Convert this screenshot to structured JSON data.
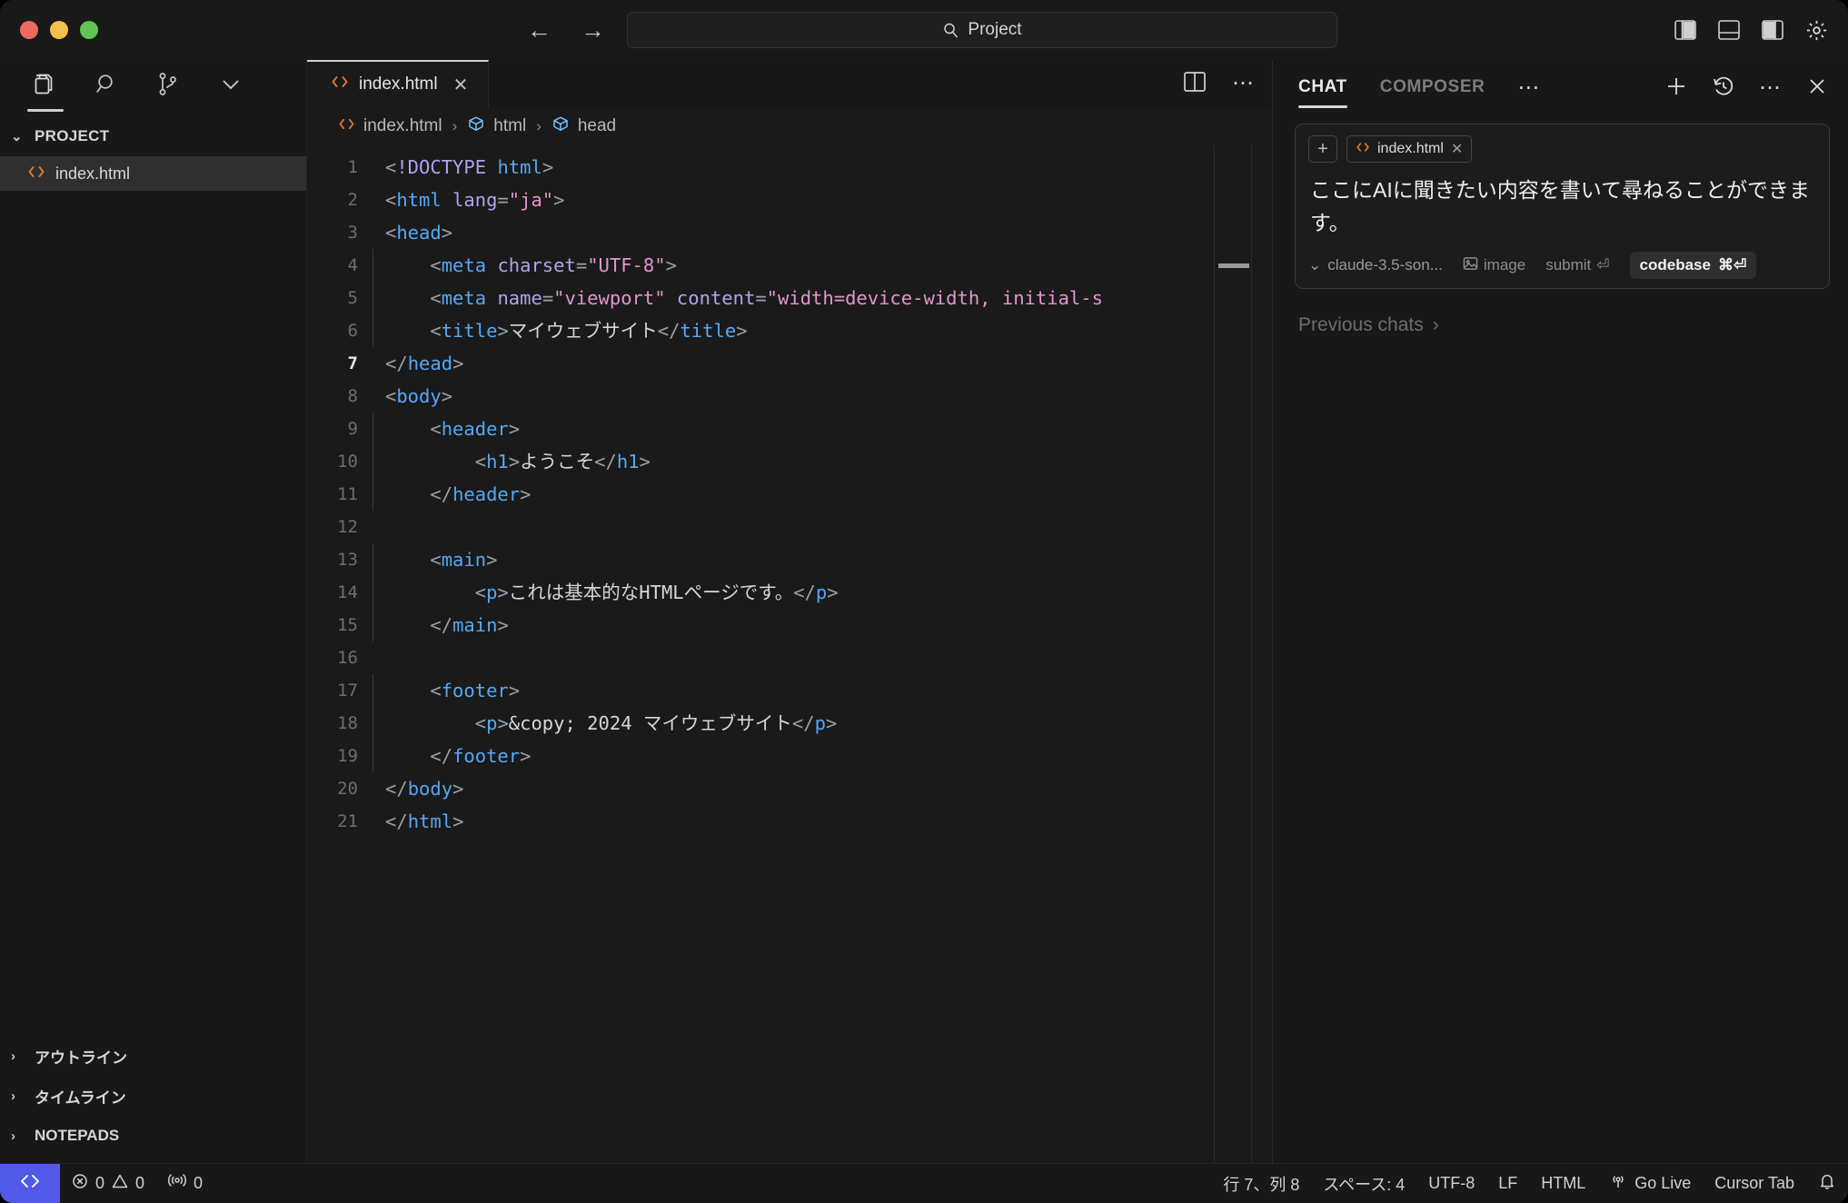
{
  "titlebar": {
    "search_value": "Project",
    "search_icon": "search-icon",
    "back_icon": "←",
    "forward_icon": "→",
    "layout_icons": [
      "toggle-primary-sidebar-icon",
      "toggle-panel-icon",
      "toggle-secondary-sidebar-icon",
      "settings-gear-icon"
    ]
  },
  "activitybar": {
    "items": [
      {
        "name": "explorer-icon",
        "active": true
      },
      {
        "name": "search-icon",
        "active": false
      },
      {
        "name": "source-control-icon",
        "active": false
      },
      {
        "name": "chevron-down-icon",
        "active": false
      }
    ]
  },
  "sidebar": {
    "title": "PROJECT",
    "chevron_open": "⌄",
    "files": [
      {
        "label": "index.html",
        "icon": "html-file-icon",
        "selected": true
      }
    ],
    "sections": [
      {
        "label": "アウトライン",
        "chevron": "›"
      },
      {
        "label": "タイムライン",
        "chevron": "›"
      },
      {
        "label": "NOTEPADS",
        "chevron": "›"
      }
    ]
  },
  "editor": {
    "tab": {
      "label": "index.html",
      "icon": "html-file-icon",
      "close": "✕"
    },
    "actions": {
      "split_icon": "split-editor-icon",
      "more": "⋯"
    },
    "breadcrumb": [
      {
        "label": "index.html",
        "icon": "html-file-icon"
      },
      {
        "label": "html",
        "icon": "symbol-cube-icon"
      },
      {
        "label": "head",
        "icon": "symbol-cube-icon"
      }
    ],
    "breadcrumb_separator": "›",
    "cursor_line": 7,
    "lines": [
      {
        "n": 1,
        "indent": 0,
        "guide": false,
        "tokens": [
          {
            "c": "punc",
            "t": "<"
          },
          {
            "c": "doctype",
            "t": "!DOCTYPE"
          },
          {
            "c": "text",
            "t": " "
          },
          {
            "c": "tag",
            "t": "html"
          },
          {
            "c": "punc",
            "t": ">"
          }
        ]
      },
      {
        "n": 2,
        "indent": 0,
        "guide": false,
        "tokens": [
          {
            "c": "punc",
            "t": "<"
          },
          {
            "c": "tag",
            "t": "html"
          },
          {
            "c": "text",
            "t": " "
          },
          {
            "c": "attr",
            "t": "lang"
          },
          {
            "c": "eq",
            "t": "="
          },
          {
            "c": "val",
            "t": "\"ja\""
          },
          {
            "c": "punc",
            "t": ">"
          }
        ]
      },
      {
        "n": 3,
        "indent": 0,
        "guide": false,
        "tokens": [
          {
            "c": "punc",
            "t": "<"
          },
          {
            "c": "tag",
            "t": "head"
          },
          {
            "c": "punc",
            "t": ">"
          }
        ]
      },
      {
        "n": 4,
        "indent": 1,
        "guide": true,
        "tokens": [
          {
            "c": "punc",
            "t": "<"
          },
          {
            "c": "tag",
            "t": "meta"
          },
          {
            "c": "text",
            "t": " "
          },
          {
            "c": "attr",
            "t": "charset"
          },
          {
            "c": "eq",
            "t": "="
          },
          {
            "c": "val",
            "t": "\"UTF-8\""
          },
          {
            "c": "punc",
            "t": ">"
          }
        ]
      },
      {
        "n": 5,
        "indent": 1,
        "guide": true,
        "tokens": [
          {
            "c": "punc",
            "t": "<"
          },
          {
            "c": "tag",
            "t": "meta"
          },
          {
            "c": "text",
            "t": " "
          },
          {
            "c": "attr",
            "t": "name"
          },
          {
            "c": "eq",
            "t": "="
          },
          {
            "c": "val",
            "t": "\"viewport\""
          },
          {
            "c": "text",
            "t": " "
          },
          {
            "c": "attr",
            "t": "content"
          },
          {
            "c": "eq",
            "t": "="
          },
          {
            "c": "val",
            "t": "\"width=device-width, initial-s"
          }
        ]
      },
      {
        "n": 6,
        "indent": 1,
        "guide": true,
        "tokens": [
          {
            "c": "punc",
            "t": "<"
          },
          {
            "c": "tag",
            "t": "title"
          },
          {
            "c": "punc",
            "t": ">"
          },
          {
            "c": "text",
            "t": "マイウェブサイト"
          },
          {
            "c": "punc",
            "t": "</"
          },
          {
            "c": "tag",
            "t": "title"
          },
          {
            "c": "punc",
            "t": ">"
          }
        ]
      },
      {
        "n": 7,
        "indent": 0,
        "guide": false,
        "current": true,
        "tokens": [
          {
            "c": "punc",
            "t": "</"
          },
          {
            "c": "tag",
            "t": "head"
          },
          {
            "c": "punc",
            "t": ">"
          }
        ]
      },
      {
        "n": 8,
        "indent": 0,
        "guide": false,
        "tokens": [
          {
            "c": "punc",
            "t": "<"
          },
          {
            "c": "tag",
            "t": "body"
          },
          {
            "c": "punc",
            "t": ">"
          }
        ]
      },
      {
        "n": 9,
        "indent": 1,
        "guide": true,
        "tokens": [
          {
            "c": "punc",
            "t": "<"
          },
          {
            "c": "tag",
            "t": "header"
          },
          {
            "c": "punc",
            "t": ">"
          }
        ]
      },
      {
        "n": 10,
        "indent": 2,
        "guide": true,
        "tokens": [
          {
            "c": "punc",
            "t": "<"
          },
          {
            "c": "tag",
            "t": "h1"
          },
          {
            "c": "punc",
            "t": ">"
          },
          {
            "c": "text",
            "t": "ようこそ"
          },
          {
            "c": "punc",
            "t": "</"
          },
          {
            "c": "tag",
            "t": "h1"
          },
          {
            "c": "punc",
            "t": ">"
          }
        ]
      },
      {
        "n": 11,
        "indent": 1,
        "guide": true,
        "tokens": [
          {
            "c": "punc",
            "t": "</"
          },
          {
            "c": "tag",
            "t": "header"
          },
          {
            "c": "punc",
            "t": ">"
          }
        ]
      },
      {
        "n": 12,
        "indent": 0,
        "guide": false,
        "tokens": []
      },
      {
        "n": 13,
        "indent": 1,
        "guide": true,
        "tokens": [
          {
            "c": "punc",
            "t": "<"
          },
          {
            "c": "tag",
            "t": "main"
          },
          {
            "c": "punc",
            "t": ">"
          }
        ]
      },
      {
        "n": 14,
        "indent": 2,
        "guide": true,
        "tokens": [
          {
            "c": "punc",
            "t": "<"
          },
          {
            "c": "tag",
            "t": "p"
          },
          {
            "c": "punc",
            "t": ">"
          },
          {
            "c": "text",
            "t": "これは基本的なHTMLページです。"
          },
          {
            "c": "punc",
            "t": "</"
          },
          {
            "c": "tag",
            "t": "p"
          },
          {
            "c": "punc",
            "t": ">"
          }
        ]
      },
      {
        "n": 15,
        "indent": 1,
        "guide": true,
        "tokens": [
          {
            "c": "punc",
            "t": "</"
          },
          {
            "c": "tag",
            "t": "main"
          },
          {
            "c": "punc",
            "t": ">"
          }
        ]
      },
      {
        "n": 16,
        "indent": 0,
        "guide": false,
        "tokens": []
      },
      {
        "n": 17,
        "indent": 1,
        "guide": true,
        "tokens": [
          {
            "c": "punc",
            "t": "<"
          },
          {
            "c": "tag",
            "t": "footer"
          },
          {
            "c": "punc",
            "t": ">"
          }
        ]
      },
      {
        "n": 18,
        "indent": 2,
        "guide": true,
        "tokens": [
          {
            "c": "punc",
            "t": "<"
          },
          {
            "c": "tag",
            "t": "p"
          },
          {
            "c": "punc",
            "t": ">"
          },
          {
            "c": "text",
            "t": "&copy; 2024 マイウェブサイト"
          },
          {
            "c": "punc",
            "t": "</"
          },
          {
            "c": "tag",
            "t": "p"
          },
          {
            "c": "punc",
            "t": ">"
          }
        ]
      },
      {
        "n": 19,
        "indent": 1,
        "guide": true,
        "tokens": [
          {
            "c": "punc",
            "t": "</"
          },
          {
            "c": "tag",
            "t": "footer"
          },
          {
            "c": "punc",
            "t": ">"
          }
        ]
      },
      {
        "n": 20,
        "indent": 0,
        "guide": false,
        "tokens": [
          {
            "c": "punc",
            "t": "</"
          },
          {
            "c": "tag",
            "t": "body"
          },
          {
            "c": "punc",
            "t": ">"
          }
        ]
      },
      {
        "n": 21,
        "indent": 0,
        "guide": false,
        "tokens": [
          {
            "c": "punc",
            "t": "</"
          },
          {
            "c": "tag",
            "t": "html"
          },
          {
            "c": "punc",
            "t": ">"
          }
        ]
      }
    ]
  },
  "chat": {
    "tabs": [
      {
        "label": "CHAT",
        "active": true
      },
      {
        "label": "COMPOSER",
        "active": false
      }
    ],
    "tabs_more": "⋯",
    "header_icons": [
      "new-chat-icon",
      "history-icon",
      "more-actions-icon",
      "close-icon"
    ],
    "context": {
      "add_label": "+",
      "chip_label": "index.html",
      "chip_close": "✕"
    },
    "message": "ここにAIに聞きたい内容を書いて尋ねることができます。",
    "footer": {
      "model": "claude-3.5-son...",
      "model_chevron": "⌄",
      "image_label": "image",
      "submit_label": "submit",
      "submit_key": "⏎",
      "codebase_label": "codebase",
      "codebase_keys": "⌘⏎"
    },
    "previous_chats": "Previous chats",
    "previous_chats_chevron": "›"
  },
  "statusbar": {
    "remote_icon": "remote-window-icon",
    "errors": "0",
    "warnings": "0",
    "ports": "0",
    "cursor_position": "行 7、列 8",
    "indentation": "スペース: 4",
    "encoding": "UTF-8",
    "eol": "LF",
    "language": "HTML",
    "go_live": "Go Live",
    "cursor_tab": "Cursor Tab",
    "bell_icon": "notifications-bell-icon"
  },
  "colors": {
    "accent_remote": "#5159e8",
    "file_icon_orange": "#e37933",
    "symbol_blue": "#75beff",
    "tag_blue": "#56a8f5",
    "attr_purple": "#b0a4f0",
    "value_pink": "#e295cc"
  }
}
